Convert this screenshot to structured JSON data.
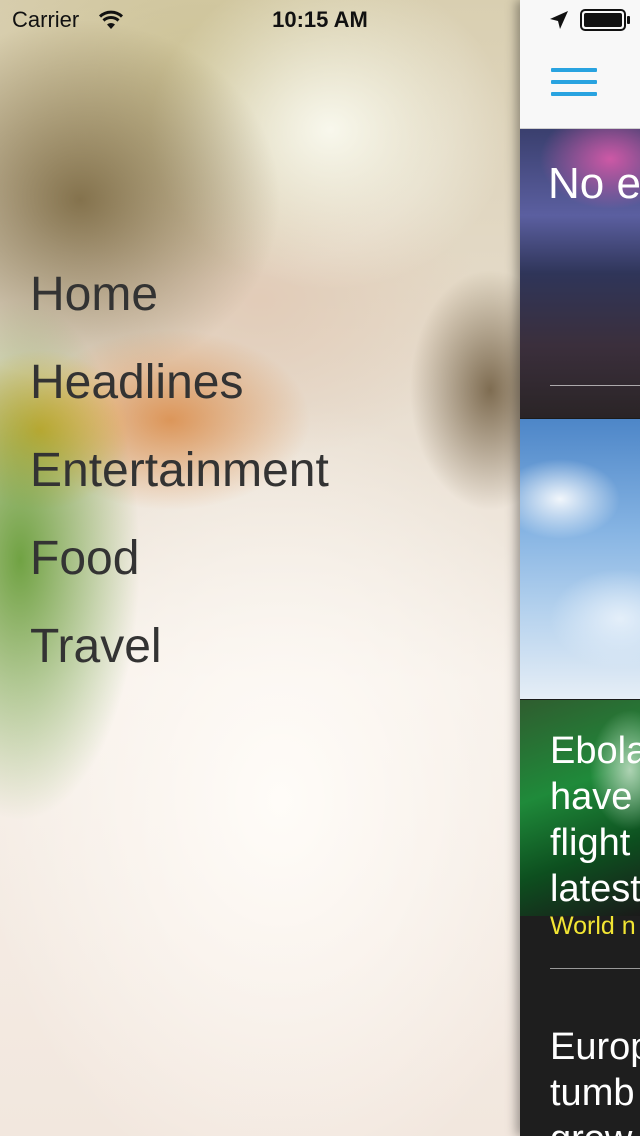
{
  "status_bar": {
    "carrier": "Carrier",
    "time": "10:15 AM",
    "icons": [
      "wifi-icon",
      "location-icon",
      "battery-icon"
    ]
  },
  "menu": {
    "items": [
      {
        "label": "Home"
      },
      {
        "label": "Headlines"
      },
      {
        "label": "Entertainment"
      },
      {
        "label": "Food"
      },
      {
        "label": "Travel"
      }
    ]
  },
  "content": {
    "nav": {
      "icon": "hamburger-icon",
      "accent": "#29a3e0"
    },
    "cards": [
      {
        "title": "No e"
      },
      {
        "title": ""
      },
      {
        "story_title_lines": [
          "Ebola",
          "have",
          "flight",
          "latest"
        ],
        "category": "World n",
        "category_color": "#f2e533",
        "next_story_lines": [
          "Europ",
          "tumb",
          "grow"
        ]
      }
    ]
  }
}
